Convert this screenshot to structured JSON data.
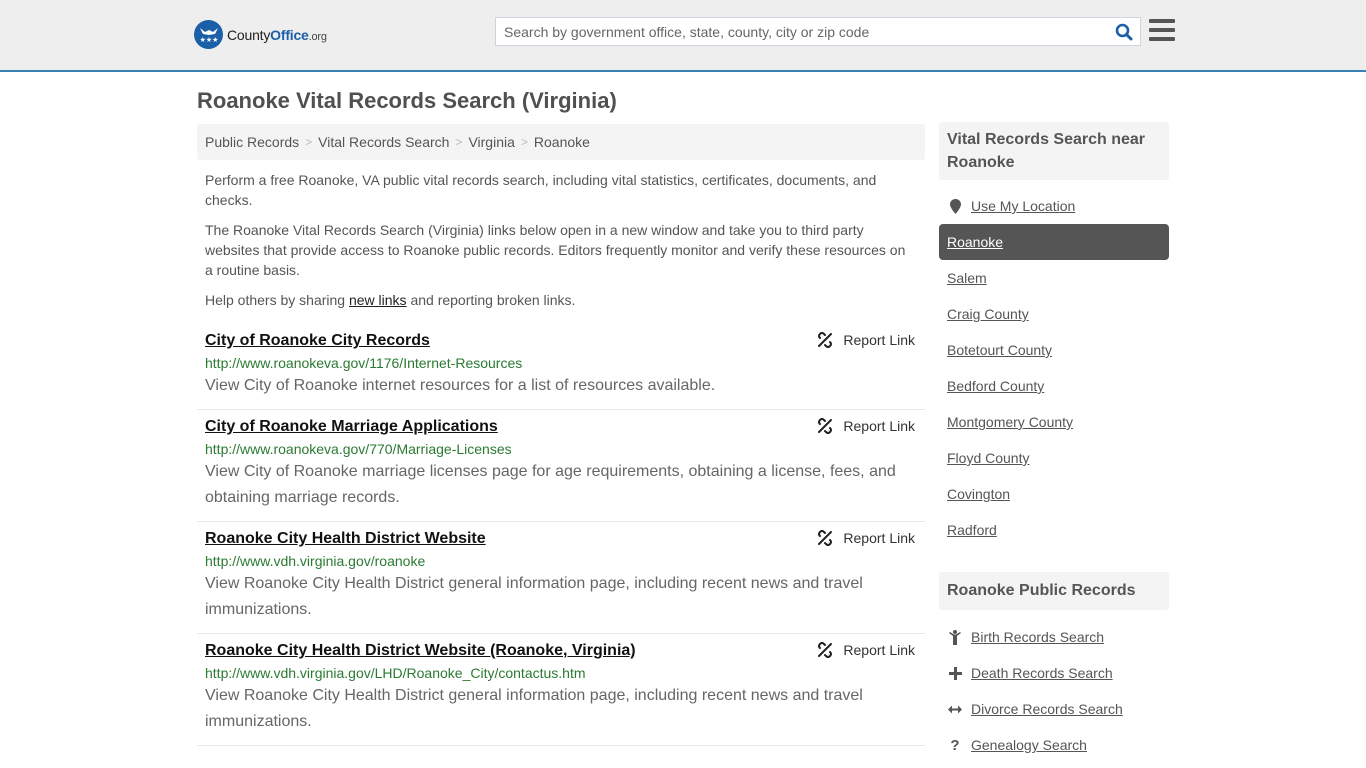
{
  "header": {
    "logo": {
      "name": "County",
      "name_bold": "Office",
      "tld": ".org"
    },
    "search": {
      "placeholder": "Search by government office, state, county, city or zip code",
      "value": ""
    },
    "colors": {
      "brand": "#1b5fa8",
      "header_border": "#3a7fb4"
    }
  },
  "page": {
    "title": "Roanoke Vital Records Search (Virginia)",
    "breadcrumb": [
      {
        "label": "Public Records"
      },
      {
        "label": "Vital Records Search"
      },
      {
        "label": "Virginia"
      },
      {
        "label": "Roanoke"
      }
    ],
    "breadcrumb_separator": ">",
    "intro": {
      "p1": "Perform a free Roanoke, VA public vital records search, including vital statistics, certificates, documents, and checks.",
      "p2": "The Roanoke Vital Records Search (Virginia) links below open in a new window and take you to third party websites that provide access to Roanoke public records. Editors frequently monitor and verify these resources on a routine basis.",
      "p3_before": "Help others by sharing ",
      "p3_link": "new links",
      "p3_after": " and reporting broken links."
    }
  },
  "results": [
    {
      "title": "City of Roanoke City Records",
      "url": "http://www.roanokeva.gov/1176/Internet-Resources",
      "description": "View City of Roanoke internet resources for a list of resources available.",
      "report_label": "Report Link"
    },
    {
      "title": "City of Roanoke Marriage Applications",
      "url": "http://www.roanokeva.gov/770/Marriage-Licenses",
      "description": "View City of Roanoke marriage licenses page for age requirements, obtaining a license, fees, and obtaining marriage records.",
      "report_label": "Report Link"
    },
    {
      "title": "Roanoke City Health District Website",
      "url": "http://www.vdh.virginia.gov/roanoke",
      "description": "View Roanoke City Health District general information page, including recent news and travel immunizations.",
      "report_label": "Report Link"
    },
    {
      "title": "Roanoke City Health District Website (Roanoke, Virginia)",
      "url": "http://www.vdh.virginia.gov/LHD/Roanoke_City/contactus.htm",
      "description": "View Roanoke City Health District general information page, including recent news and travel immunizations.",
      "report_label": "Report Link"
    }
  ],
  "sidebar": {
    "nearby": {
      "heading": "Vital Records Search near Roanoke",
      "use_location": "Use My Location",
      "items": [
        {
          "label": "Roanoke",
          "active": true
        },
        {
          "label": "Salem"
        },
        {
          "label": "Craig County"
        },
        {
          "label": "Botetourt County"
        },
        {
          "label": "Bedford County"
        },
        {
          "label": "Montgomery County"
        },
        {
          "label": "Floyd County"
        },
        {
          "label": "Covington"
        },
        {
          "label": "Radford"
        }
      ]
    },
    "public_records": {
      "heading": "Roanoke Public Records",
      "items": [
        {
          "label": "Birth Records Search",
          "icon": "child-icon"
        },
        {
          "label": "Death Records Search",
          "icon": "plus-icon"
        },
        {
          "label": "Divorce Records Search",
          "icon": "arrows-h-icon"
        },
        {
          "label": "Genealogy Search",
          "icon": "question-icon"
        }
      ]
    }
  }
}
